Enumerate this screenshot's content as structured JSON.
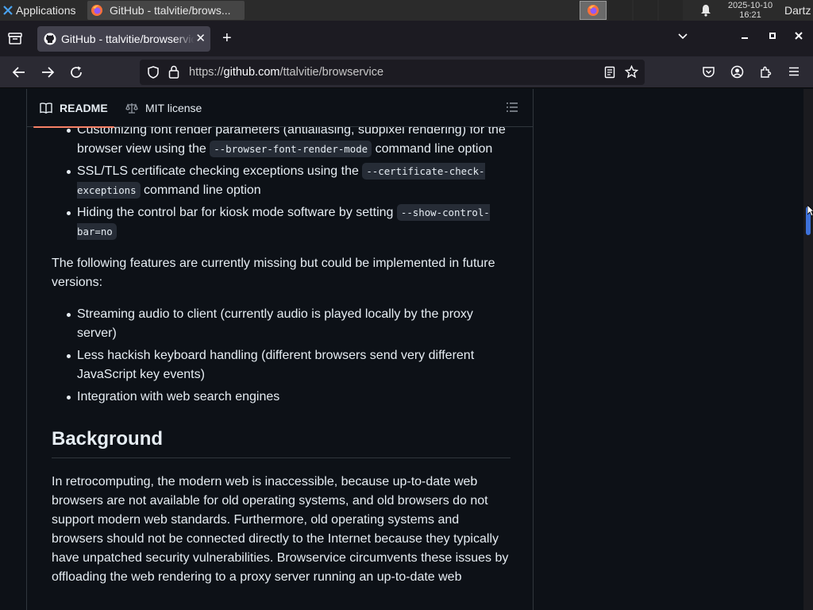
{
  "taskbar": {
    "applications_label": "Applications",
    "task_title": "GitHub - ttalvitie/brows...",
    "clock_date": "2025-10-10",
    "clock_time": "16:21",
    "user": "Dartz"
  },
  "browser": {
    "tab_title": "GitHub - ttalvitie/browservice",
    "url_prefix": "https://",
    "url_host": "github.com",
    "url_path": "/ttalvitie/browservice"
  },
  "readme": {
    "tabs": [
      {
        "label": "README",
        "icon": "book-icon"
      },
      {
        "label": "MIT license",
        "icon": "scale-icon"
      }
    ],
    "features_list": [
      {
        "pre": "Customizing font render parameters (antialiasing, subpixel rendering) for the browser view using the ",
        "code": "--browser-font-render-mode",
        "post": " command line option"
      },
      {
        "pre": "SSL/TLS certificate checking exceptions using the ",
        "code": "--certificate-check-exceptions",
        "post": " command line option"
      },
      {
        "pre": "Hiding the control bar for kiosk mode software by setting ",
        "code": "--show-control-bar=no",
        "post": ""
      }
    ],
    "missing_intro": "The following features are currently missing but could be implemented in future versions:",
    "missing_list": [
      "Streaming audio to client (currently audio is played locally by the proxy server)",
      "Less hackish keyboard handling (different browsers send very different JavaScript key events)",
      "Integration with web search engines"
    ],
    "background_heading": "Background",
    "background_text": "In retrocomputing, the modern web is inaccessible, because up-to-date web browsers are not available for old operating systems, and old browsers do not support modern web standards. Furthermore, old operating systems and browsers should not be connected directly to the Internet because they typically have unpatched security vulnerabilities. Browservice circumvents these issues by offloading the web rendering to a proxy server running an up-to-date web"
  },
  "colors": {
    "page_bg": "#0d1117",
    "text": "#e6edf3",
    "active_tab_underline": "#f78166",
    "scroll_thumb": "#3d71d9"
  }
}
